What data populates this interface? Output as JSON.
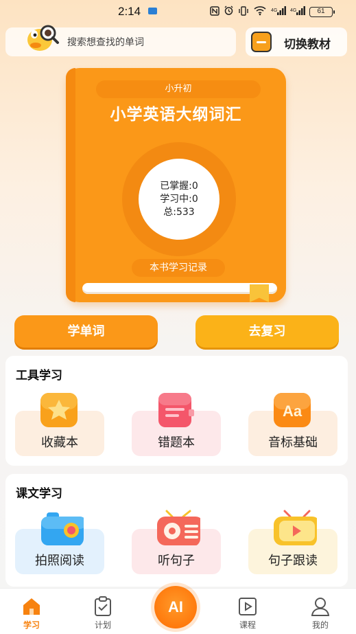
{
  "status_bar": {
    "time": "2:14",
    "icons": [
      "nfc-icon",
      "alarm-icon",
      "vibrate-icon",
      "wifi-icon",
      "signal-icon",
      "signal-icon"
    ],
    "battery": "61"
  },
  "search": {
    "placeholder": "搜索想查找的单词"
  },
  "switch_textbook": {
    "label": "切换教材"
  },
  "book": {
    "tag": "小升初",
    "title": "小学英语大纲词汇",
    "mastered": "已掌握:0",
    "learning": "学习中:0",
    "total": "总:533",
    "record_label": "本书学习记录"
  },
  "actions": {
    "learn_label": "学单词",
    "review_label": "去复习"
  },
  "tools": {
    "title": "工具学习",
    "items": [
      {
        "label": "收藏本",
        "icon": "star-icon",
        "bg": "#fdeee0",
        "color": "#f9a11b"
      },
      {
        "label": "错题本",
        "icon": "notebook-icon",
        "bg": "#fde8ea",
        "color": "#f4566a"
      },
      {
        "label": "音标基础",
        "icon": "phonetic-aa-icon",
        "bg": "#fdeee0",
        "color": "#fb8a14"
      }
    ]
  },
  "lessons": {
    "title": "课文学习",
    "items": [
      {
        "label": "拍照阅读",
        "icon": "camera-icon",
        "bg": "#e3f1fd",
        "color": "#33a6f1"
      },
      {
        "label": "听句子",
        "icon": "radio-icon",
        "bg": "#fde8ea",
        "color": "#f4685a"
      },
      {
        "label": "句子跟读",
        "icon": "tv-play-icon",
        "bg": "#fdf4dc",
        "color": "#f8c22a"
      }
    ]
  },
  "nav": {
    "items": [
      {
        "label": "学习",
        "icon": "home-icon",
        "active": true
      },
      {
        "label": "计划",
        "icon": "clipboard-check-icon",
        "active": false
      },
      {
        "label": "AI",
        "icon": "ai-icon",
        "active": false
      },
      {
        "label": "课程",
        "icon": "play-box-icon",
        "active": false
      },
      {
        "label": "我的",
        "icon": "user-icon",
        "active": false
      }
    ]
  },
  "colors": {
    "primary": "#fb9818",
    "accent": "#f7820f",
    "review": "#fbb218"
  }
}
